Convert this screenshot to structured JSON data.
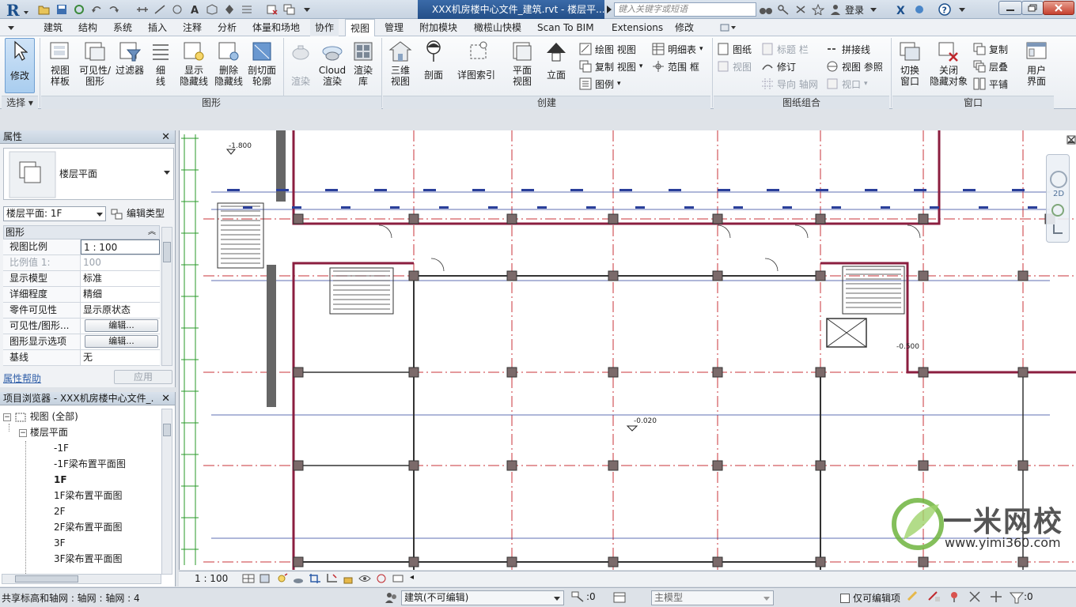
{
  "titlebar": {
    "document_title": "XXX机房楼中心文件_建筑.rvt - 楼层平...",
    "search_placeholder": "键入关键字或短语",
    "login_label": "登录",
    "colors": {
      "app_red": "#c0282d",
      "doc_tab": "#2c5b98"
    }
  },
  "ribbon_tabs": [
    "建筑",
    "结构",
    "系统",
    "插入",
    "注释",
    "分析",
    "体量和场地",
    "协作",
    "视图",
    "管理",
    "附加模块",
    "橄榄山快模",
    "Scan To BIM",
    "Extensions",
    "修改"
  ],
  "ribbon_active_tab": "视图",
  "ribbon": {
    "select": {
      "modify": "修改",
      "panel": "选择"
    },
    "graphics": {
      "panel": "图形",
      "view_template_1": "视图",
      "view_template_2": "样板",
      "visibility_1": "可见性/",
      "visibility_2": "图形",
      "filters": "过滤器",
      "thin_1": "细",
      "thin_2": "线",
      "show_hidden_1": "显示",
      "show_hidden_2": "隐藏线",
      "remove_hidden_1": "删除",
      "remove_hidden_2": "隐藏线",
      "cut_profile_1": "剖切面",
      "cut_profile_2": "轮廓",
      "render": "渲染",
      "cloud_1": "Cloud",
      "cloud_2": "渲染",
      "gallery_1": "渲染",
      "gallery_2": "库"
    },
    "create": {
      "panel": "创建",
      "three_d_1": "三维",
      "three_d_2": "视图",
      "section": "剖面",
      "callout": "详图索引",
      "plan_1": "平面",
      "plan_2": "视图",
      "elevation": "立面",
      "drafting_view": "绘图 视图",
      "duplicate_view": "复制 视图",
      "legend": "图例",
      "schedule": "明细表",
      "scope_box": "范围 框"
    },
    "sheet": {
      "panel": "图纸组合",
      "sheet": "图纸",
      "title_block": "标题 栏",
      "view": "视图",
      "revision": "修订",
      "guide_grid": "导向 轴网",
      "matchline": "拼接线",
      "view_reference": "视图 参照",
      "viewports": "视口"
    },
    "windows": {
      "panel": "窗口",
      "switch_1": "切换",
      "switch_2": "窗口",
      "close_hidden_1": "关闭",
      "close_hidden_2": "隐藏对象",
      "replicate": "复制",
      "cascade": "层叠",
      "tile": "平铺",
      "ui_1": "用户",
      "ui_2": "界面"
    }
  },
  "properties": {
    "title": "属性",
    "type_name": "楼层平面",
    "view_selector": "楼层平面: 1F",
    "edit_type": "编辑类型",
    "group": "图形",
    "rows": [
      {
        "key": "视图比例",
        "value": "1 : 100"
      },
      {
        "key": "比例值 1:",
        "value": "100"
      },
      {
        "key": "显示模型",
        "value": "标准"
      },
      {
        "key": "详细程度",
        "value": "精细"
      },
      {
        "key": "零件可见性",
        "value": "显示原状态"
      },
      {
        "key": "可见性/图形...",
        "value": "编辑..."
      },
      {
        "key": "图形显示选项",
        "value": "编辑..."
      },
      {
        "key": "基线",
        "value": "无"
      }
    ],
    "help": "属性帮助",
    "apply": "应用"
  },
  "browser": {
    "title": "项目浏览器 - XXX机房楼中心文件_...",
    "root": "视图 (全部)",
    "group": "楼层平面",
    "items": [
      "-1F",
      "-1F梁布置平面图",
      "1F",
      "1F梁布置平面图",
      "2F",
      "2F梁布置平面图",
      "3F",
      "3F梁布置平面图"
    ],
    "active_item": "1F"
  },
  "canvas": {
    "labels": [
      "-1.800",
      "-0.020",
      "-0.500"
    ],
    "nav_2d": "2D"
  },
  "watermark": {
    "brand": "一米网校",
    "url": "www.yimi360.com"
  },
  "viewbar": {
    "scale": "1 : 100"
  },
  "statusbar": {
    "message": "共享标高和轴网 : 轴网 : 轴网 : 4",
    "workset": "建筑(不可编辑)",
    "count_1": ":0",
    "design_option": "主模型",
    "editable_only": "仅可编辑项",
    "count_2": ":0"
  }
}
